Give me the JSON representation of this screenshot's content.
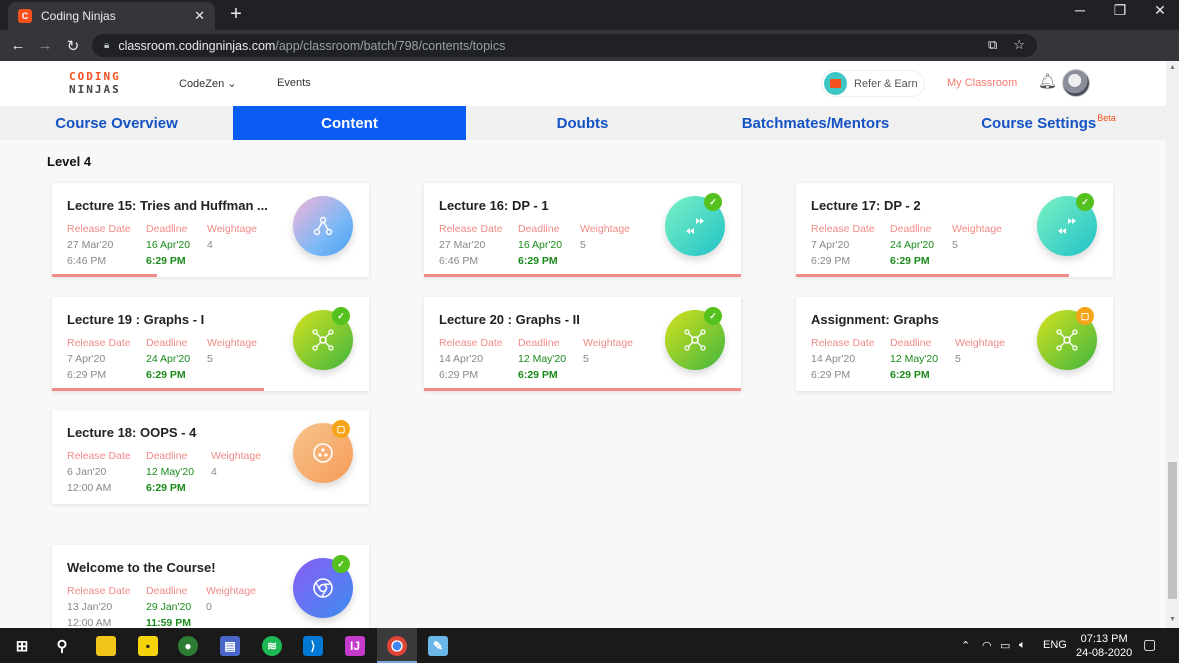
{
  "browser": {
    "tab_title": "Coding Ninjas",
    "url_host": "classroom.codingninjas.com",
    "url_path": "/app/classroom/batch/798/contents/topics"
  },
  "header": {
    "logo_line1": "CODING",
    "logo_line2": "NINJAS",
    "nav_codezen": "CodeZen ⌄",
    "nav_events": "Events",
    "refer_label": "Refer & Earn",
    "my_classroom": "My Classroom"
  },
  "course_tabs": [
    {
      "label": "Course Overview",
      "active": false
    },
    {
      "label": "Content",
      "active": true
    },
    {
      "label": "Doubts",
      "active": false
    },
    {
      "label": "Batchmates/Mentors",
      "active": false
    },
    {
      "label": "Course Settings",
      "sup": "Beta",
      "active": false
    }
  ],
  "level_title": "Level 4",
  "field_labels": {
    "release": "Release Date",
    "deadline": "Deadline",
    "weightage": "Weightage"
  },
  "cards": [
    {
      "title": "Lecture 15: Tries and Huffman ...",
      "release_date": "27 Mar'20",
      "release_time": "6:46 PM",
      "deadline_date": "16 Apr'20",
      "deadline_time": "6:29 PM",
      "weightage": "4",
      "icon": "share-node-icon",
      "status": "none",
      "progress": 0.33
    },
    {
      "title": "Lecture 16: DP - 1",
      "release_date": "27 Mar'20",
      "release_time": "6:46 PM",
      "deadline_date": "16 Apr'20",
      "deadline_time": "6:29 PM",
      "weightage": "5",
      "icon": "fast-forward-icon",
      "status": "done",
      "progress": 1.0
    },
    {
      "title": "Lecture 17: DP - 2",
      "release_date": "7 Apr'20",
      "release_time": "6:29 PM",
      "deadline_date": "24 Apr'20",
      "deadline_time": "6:29 PM",
      "weightage": "5",
      "icon": "fast-forward-icon",
      "status": "done",
      "progress": 0.86
    },
    {
      "title": "Lecture 19 : Graphs - I",
      "release_date": "7 Apr'20",
      "release_time": "6:29 PM",
      "deadline_date": "24 Apr'20",
      "deadline_time": "6:29 PM",
      "weightage": "5",
      "icon": "graph-network-icon",
      "status": "done",
      "progress": 0.67
    },
    {
      "title": "Lecture 20 : Graphs - II",
      "release_date": "14 Apr'20",
      "release_time": "6:29 PM",
      "deadline_date": "12 May'20",
      "deadline_time": "6:29 PM",
      "weightage": "5",
      "icon": "graph-network-icon",
      "status": "done",
      "progress": 1.0
    },
    {
      "title": "Assignment: Graphs",
      "release_date": "14 Apr'20",
      "release_time": "6:29 PM",
      "deadline_date": "12 May'20",
      "deadline_time": "6:29 PM",
      "weightage": "5",
      "icon": "graph-network-icon",
      "status": "pending",
      "progress": 0
    },
    {
      "title": "Lecture 18: OOPS - 4",
      "release_date": "6 Jan'20",
      "release_time": "12:00 AM",
      "deadline_date": "12 May'20",
      "deadline_time": "6:29 PM",
      "weightage": "4",
      "icon": "dots-circle-icon",
      "status": "pending",
      "progress": 0
    },
    {
      "title": "Welcome to the Course!",
      "release_date": "13 Jan'20",
      "release_time": "12:00 AM",
      "deadline_date": "29 Jan'20",
      "deadline_time": "11:59 PM",
      "weightage": "0",
      "icon": "chrome-hex-icon",
      "status": "done",
      "progress": 0
    }
  ],
  "colors": {
    "accent_blue": "#0b5cf5",
    "label_pink": "#f08b86",
    "deadline_green": "#1a8a1a",
    "done_badge": "#55c11f",
    "pending_badge": "#f6a417"
  },
  "taskbar": {
    "lang": "ENG",
    "time": "07:13 PM",
    "date": "24-08-2020"
  }
}
